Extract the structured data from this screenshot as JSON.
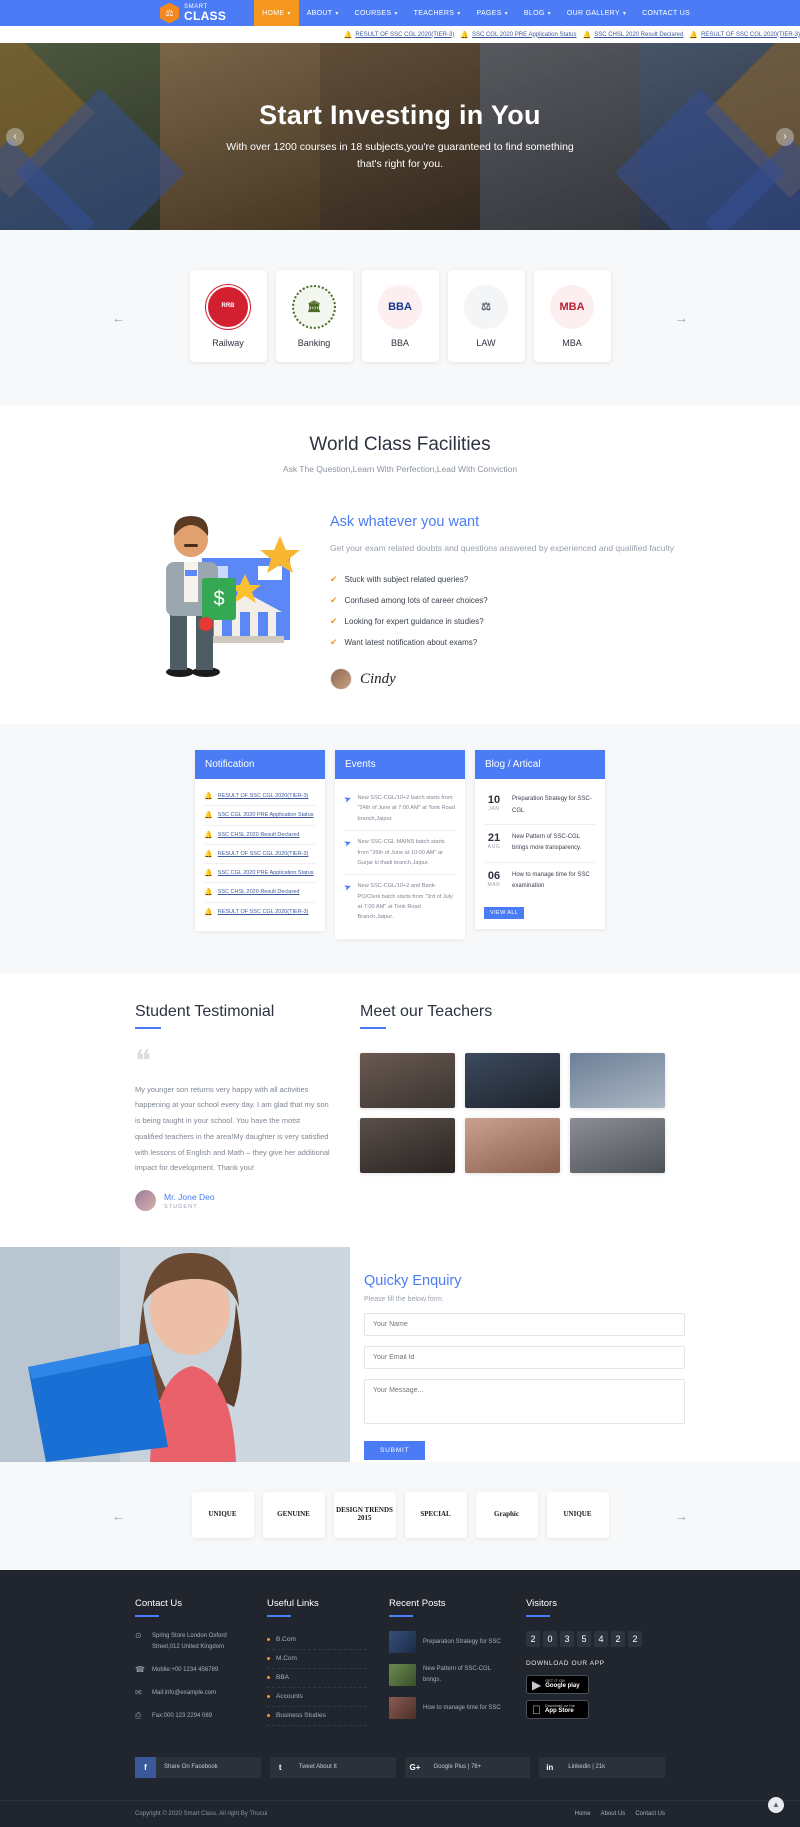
{
  "header": {
    "logo": {
      "line1": "SMART",
      "line2": "CLASS",
      "icon": "graduation-hex-icon"
    },
    "nav": [
      {
        "label": "HOME",
        "caret": true,
        "active": true
      },
      {
        "label": "ABOUT",
        "caret": true,
        "active": false
      },
      {
        "label": "COURSES",
        "caret": true,
        "active": false
      },
      {
        "label": "TEACHERS",
        "caret": true,
        "active": false
      },
      {
        "label": "PAGES",
        "caret": true,
        "active": false
      },
      {
        "label": "BLOG",
        "caret": true,
        "active": false
      },
      {
        "label": "OUR GALLERY",
        "caret": true,
        "active": false
      },
      {
        "label": "CONTACT US",
        "caret": false,
        "active": false
      }
    ]
  },
  "ticker": {
    "items": [
      "RESULT OF SSC CGL 2020(TIER-3)",
      "SSC CGL 2020 PRE Application Status",
      "SSC CHSL 2020 Result Declared",
      "RESULT OF SSC CGL 2020(TIER-3)"
    ]
  },
  "hero": {
    "title": "Start Investing in You",
    "subtitle": "With over 1200 courses in 18 subjects,you're guaranteed to find something that's right for you.",
    "prev": "‹",
    "next": "›"
  },
  "courses": {
    "prev": "←",
    "next": "→",
    "items": [
      {
        "label": "Railway",
        "icon": "railway-seal-icon",
        "glyph": "RRB"
      },
      {
        "label": "Banking",
        "icon": "bank-building-icon",
        "glyph": "🏛"
      },
      {
        "label": "BBA",
        "icon": "bba-house-icon",
        "glyph": "BBA"
      },
      {
        "label": "LAW",
        "icon": "law-scales-icon",
        "glyph": "⚖"
      },
      {
        "label": "MBA",
        "icon": "mba-cap-icon",
        "glyph": "MBA"
      }
    ]
  },
  "facilities": {
    "title": "World Class Facilities",
    "subtitle": "Ask The Question,Learn With Perfection,Lead With Conviction",
    "heading": "Ask whatever you want",
    "paragraph": "Get your exam related doubts and questions answered by experienced and qualified faculty",
    "bullets": [
      "Stuck with subject related queries?",
      "Confused among lots of career choices?",
      "Looking for expert guidance in studies?",
      "Want latest notification about exams?"
    ],
    "signature": "Cindy"
  },
  "notification_card": {
    "title": "Notification",
    "items": [
      "RESULT OF SSC CGL 2020(TIER-3)",
      "SSC CGL 2020 PRE Application Status",
      "SSC CHSL 2020 Result Declared",
      "RESULT OF SSC CGL 2020(TIER-3)",
      "SSC CGL 2020 PRE Application Status",
      "SSC CHSL 2020 Result Declared",
      "RESULT OF SSC CGL 2020(TIER-3)"
    ]
  },
  "events_card": {
    "title": "Events",
    "items": [
      "New SSC-CGL/10+2 batch starts from \"24th of June at 7:00 AM\" at Tonk Road branch,Jaipur.",
      "New SSC-CGL MAINS batch starts from \"26th of June at 10:00 AM\" at Gurjar ki thadi branch,Jaipur.",
      "New SSC-CGL/10+2 and Bank-PO/Clerk batch starts from \"3rd of July at 7:00 AM\" at Tonk Road Branch,Jaipur."
    ]
  },
  "blog_card": {
    "title": "Blog / Artical",
    "items": [
      {
        "day": "10",
        "month": "JAN",
        "text": "Preparation Strategy for SSC-CGL"
      },
      {
        "day": "21",
        "month": "AUG",
        "text": "New Pattern of SSC-CGL brings more transparency."
      },
      {
        "day": "06",
        "month": "MAR",
        "text": "How to manage time for SSC examination"
      }
    ],
    "view_all": "VIEW ALL"
  },
  "testimonial": {
    "title": "Student Testimonial",
    "quote": "My younger son returns very happy with all activities happening at your school every day. I am glad that my son is being taught in your school. You have the motst qualified teachers in the area!My daughter is very satisfied with lessons of English and Math – they give her additional impact for development. Thank you!",
    "author": "Mr. Jone Deo",
    "role": "STUDENT"
  },
  "teachers": {
    "title": "Meet our Teachers",
    "cells": [
      "teacher-1",
      "teacher-2",
      "teacher-3",
      "teacher-4",
      "teacher-5",
      "teacher-6"
    ]
  },
  "enquiry": {
    "title": "Quicky Enquiry",
    "subtitle": "Please fill the below form.",
    "name_placeholder": "Your Name",
    "email_placeholder": "Your Email Id",
    "message_placeholder": "Your Message...",
    "submit": "SUBMIT"
  },
  "brands": {
    "prev": "←",
    "next": "→",
    "items": [
      "UNIQUE",
      "GENUINE",
      "DESIGN TRENDS 2015",
      "SPECIAL",
      "Graphic",
      "UNIQUE"
    ]
  },
  "footer": {
    "contact": {
      "title": "Contact Us",
      "items": [
        {
          "icon": "location-pin-icon",
          "text": "Spring Store London Oxford Street,012 United Kingdom"
        },
        {
          "icon": "phone-icon",
          "text": "Mobile:+00 1234 456789"
        },
        {
          "icon": "mail-icon",
          "text": "Mail:info@example.com"
        },
        {
          "icon": "fax-icon",
          "text": "Fax:000 123 2294 089"
        }
      ]
    },
    "useful_links": {
      "title": "Useful Links",
      "items": [
        "B.Com",
        "M.Com",
        "BBA",
        "Accounts",
        "Business Studies"
      ]
    },
    "recent_posts": {
      "title": "Recent Posts",
      "items": [
        {
          "thumb": "post-thumb-1",
          "text": "Preparation Strategy for SSC"
        },
        {
          "thumb": "post-thumb-2",
          "text": "New Pattern of SSC-CGL brings."
        },
        {
          "thumb": "post-thumb-3",
          "text": "How to manage time for SSC"
        }
      ]
    },
    "visitors": {
      "title": "Visitors",
      "digits": [
        "2",
        "0",
        "3",
        "5",
        "4",
        "2",
        "2"
      ],
      "download_title": "DOWNLOAD OUR APP",
      "stores": [
        {
          "small": "GET IT ON",
          "big": "Google play",
          "icon": "google-play-icon"
        },
        {
          "small": "Download on the",
          "big": "App Store",
          "icon": "apple-icon"
        }
      ]
    },
    "social": [
      {
        "icon": "facebook-icon",
        "glyph": "f",
        "label": "Share On Facebook"
      },
      {
        "icon": "twitter-icon",
        "glyph": "t",
        "label": "Tweet About It"
      },
      {
        "icon": "google-plus-icon",
        "glyph": "G+",
        "label": "Google Plus | 76+"
      },
      {
        "icon": "linkedin-icon",
        "glyph": "in",
        "label": "Linkedin | 21k"
      }
    ],
    "copyright": "Copyright © 2020 Smart Class. All right By Thucui",
    "bottom_links": [
      "Home",
      "About Us",
      "Contact Us"
    ],
    "to_top": "▲"
  }
}
